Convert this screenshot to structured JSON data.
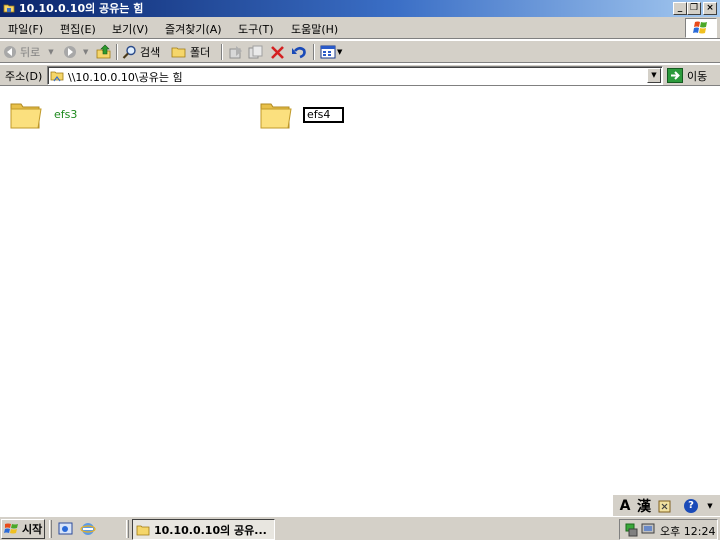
{
  "window": {
    "title": "10.10.0.10의 공유는 힘",
    "controls": {
      "minimize": "_",
      "restore": "❐",
      "close": "×"
    }
  },
  "menu": [
    {
      "label": "파일(F)"
    },
    {
      "label": "편집(E)"
    },
    {
      "label": "보기(V)"
    },
    {
      "label": "즐겨찾기(A)"
    },
    {
      "label": "도구(T)"
    },
    {
      "label": "도움말(H)"
    }
  ],
  "toolbar": {
    "back_label": "뒤로",
    "search_label": "검색",
    "folders_label": "폴더"
  },
  "address": {
    "label": "주소(D)",
    "value": "\\\\10.10.0.10\\공유는 힘",
    "go_label": "이동"
  },
  "folders": [
    {
      "name": "efs3",
      "style": "encrypted-green"
    },
    {
      "name": "efs4",
      "style": "renaming"
    }
  ],
  "langbar": {
    "a_label": "A",
    "hanja_label": "漢",
    "help_label": "?"
  },
  "taskbar": {
    "start_label": "시작",
    "task_label": "10.10.0.10의 공유...",
    "clock": "오후 12:24"
  },
  "colors": {
    "title_start": "#0a246a",
    "title_end": "#a6caf0",
    "chrome": "#d4d0c8",
    "encrypted_name": "#1d8a1d"
  }
}
